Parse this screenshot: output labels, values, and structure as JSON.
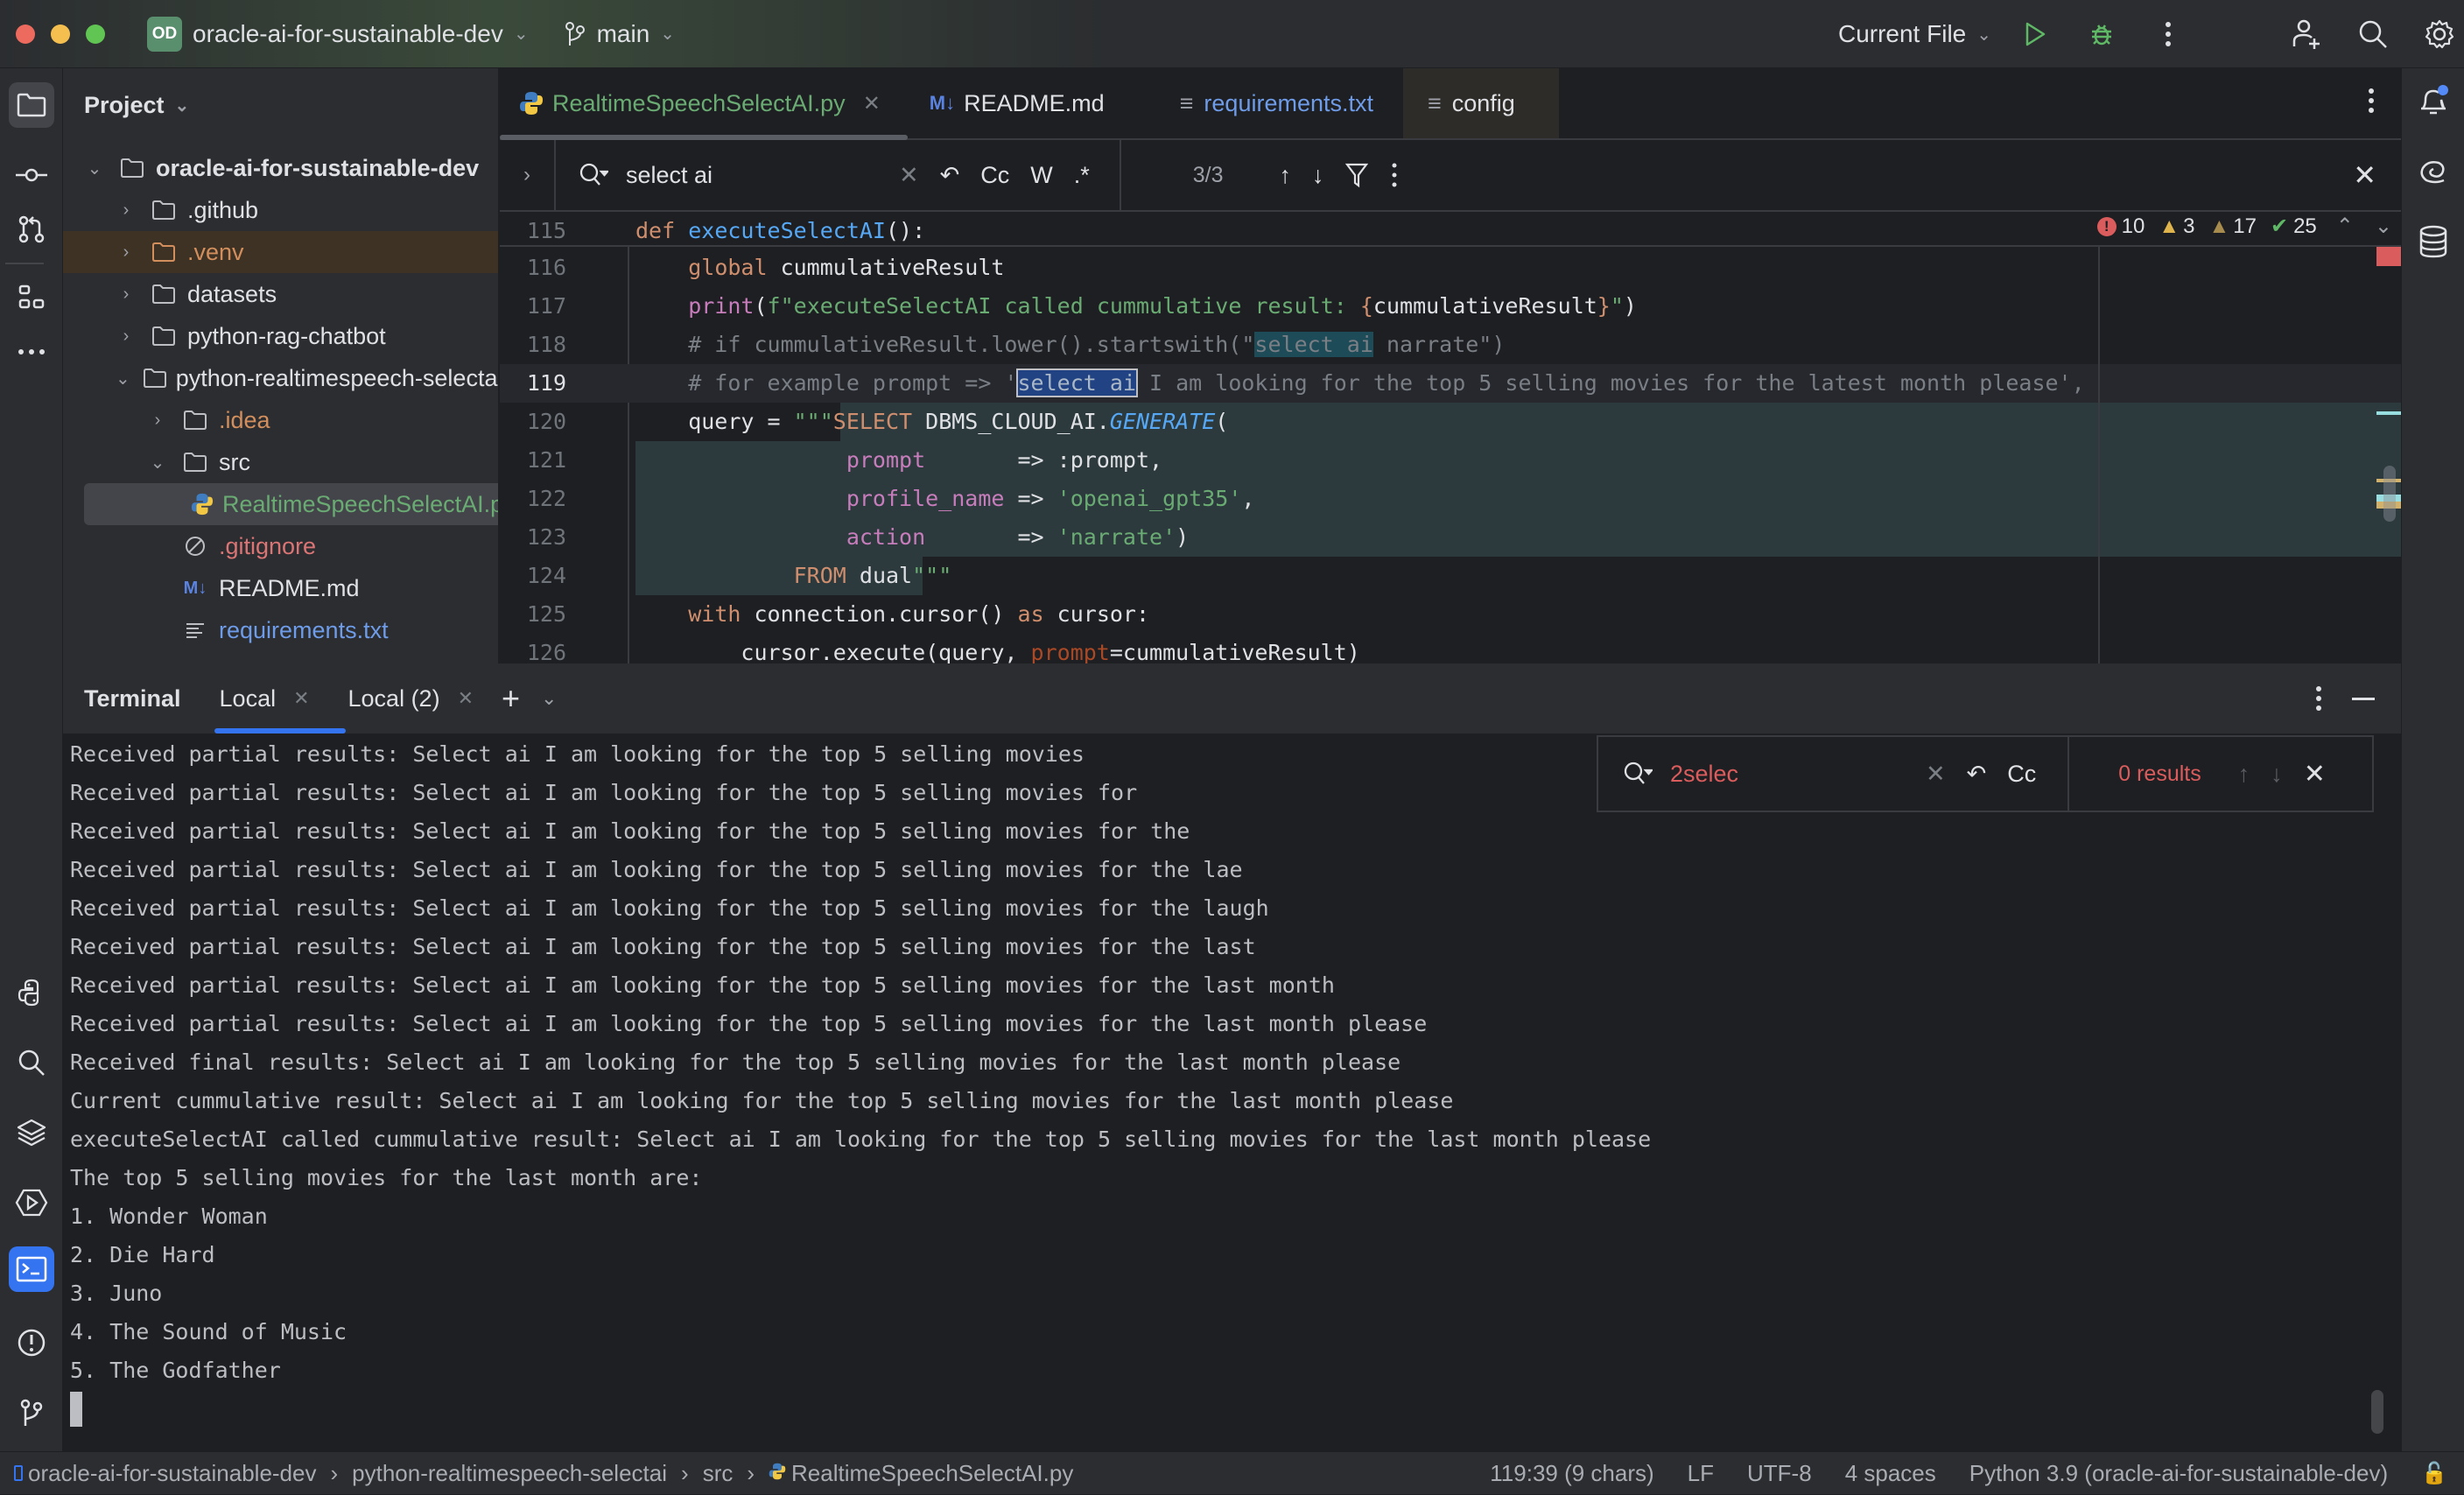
{
  "titlebar": {
    "project_badge": "OD",
    "project_name": "oracle-ai-for-sustainable-dev",
    "branch": "main",
    "run_config": "Current File"
  },
  "project_panel": {
    "title": "Project",
    "tree": [
      {
        "label": "oracle-ai-for-sustainable-dev",
        "type": "folder",
        "expanded": true,
        "level": 0,
        "bold": true
      },
      {
        "label": ".github",
        "type": "folder",
        "expanded": false,
        "level": 1
      },
      {
        "label": ".venv",
        "type": "folder-excluded",
        "expanded": false,
        "level": 1
      },
      {
        "label": "datasets",
        "type": "folder",
        "expanded": false,
        "level": 1
      },
      {
        "label": "python-rag-chatbot",
        "type": "folder",
        "expanded": false,
        "level": 1
      },
      {
        "label": "python-realtimespeech-selectai",
        "type": "folder",
        "expanded": true,
        "level": 1
      },
      {
        "label": ".idea",
        "type": "folder",
        "expanded": false,
        "level": 2
      },
      {
        "label": "src",
        "type": "folder",
        "expanded": true,
        "level": 2
      },
      {
        "label": "RealtimeSpeechSelectAI.py",
        "type": "python",
        "level": 3,
        "selected": true
      },
      {
        "label": ".gitignore",
        "type": "ignore",
        "level": 2
      },
      {
        "label": "README.md",
        "type": "markdown",
        "level": 2
      },
      {
        "label": "requirements.txt",
        "type": "text",
        "level": 2
      }
    ]
  },
  "editor": {
    "tabs": [
      {
        "label": "RealtimeSpeechSelectAI.py",
        "active": true,
        "color": "#6aab73"
      },
      {
        "label": "README.md",
        "color": "#dfe1e5"
      },
      {
        "label": "requirements.txt",
        "color": "#6f9ce8"
      },
      {
        "label": "config",
        "color": "#dfe1e5"
      }
    ],
    "find": {
      "query": "select ai",
      "match_count": "3/3",
      "opt_case": "Cc",
      "opt_word": "W",
      "opt_regex": ".*"
    },
    "inspections": {
      "errors": "10",
      "warnings": "3",
      "weak_warnings": "17",
      "ok": "25"
    },
    "lines": [
      {
        "n": "115",
        "text": "def executeSelectAI():"
      },
      {
        "n": "116",
        "text": "    global cummulativeResult"
      },
      {
        "n": "117",
        "text": "    print(f\"executeSelectAI called cummulative result: {cummulativeResult}\")"
      },
      {
        "n": "118",
        "text": "    # if cummulativeResult.lower().startswith(\"select ai narrate\")"
      },
      {
        "n": "119",
        "text": "    # for example prompt => 'select ai I am looking for the top 5 selling movies for the latest month please',"
      },
      {
        "n": "120",
        "text": "    query = \"\"\"SELECT DBMS_CLOUD_AI.GENERATE("
      },
      {
        "n": "121",
        "text": "                prompt       => :prompt,"
      },
      {
        "n": "122",
        "text": "                profile_name => 'openai_gpt35',"
      },
      {
        "n": "123",
        "text": "                action       => 'narrate')"
      },
      {
        "n": "124",
        "text": "            FROM dual\"\"\""
      },
      {
        "n": "125",
        "text": "    with connection.cursor() as cursor:"
      },
      {
        "n": "126",
        "text": "        cursor.execute(query, prompt=cummulativeResult)"
      }
    ]
  },
  "terminal": {
    "title": "Terminal",
    "tabs": [
      {
        "label": "Local",
        "active": true
      },
      {
        "label": "Local (2)"
      }
    ],
    "find": {
      "query": "2selec",
      "results": "0 results",
      "opt_case": "Cc"
    },
    "output": [
      "Received partial results: Select ai I am looking for the top 5 selling movies",
      "Received partial results: Select ai I am looking for the top 5 selling movies for",
      "Received partial results: Select ai I am looking for the top 5 selling movies for the",
      "Received partial results: Select ai I am looking for the top 5 selling movies for the lae",
      "Received partial results: Select ai I am looking for the top 5 selling movies for the laugh",
      "Received partial results: Select ai I am looking for the top 5 selling movies for the last",
      "Received partial results: Select ai I am looking for the top 5 selling movies for the last month",
      "Received partial results: Select ai I am looking for the top 5 selling movies for the last month please",
      "Received final results: Select ai I am looking for the top 5 selling movies for the last month please",
      "Current cummulative result: Select ai I am looking for the top 5 selling movies for the last month please",
      "executeSelectAI called cummulative result: Select ai I am looking for the top 5 selling movies for the last month please",
      "The top 5 selling movies for the last month are:",
      "1. Wonder Woman",
      "2. Die Hard",
      "3. Juno",
      "4. The Sound of Music",
      "5. The Godfather"
    ]
  },
  "statusbar": {
    "breadcrumb": [
      "oracle-ai-for-sustainable-dev",
      "python-realtimespeech-selectai",
      "src",
      "RealtimeSpeechSelectAI.py"
    ],
    "position": "119:39 (9 chars)",
    "line_sep": "LF",
    "encoding": "UTF-8",
    "indent": "4 spaces",
    "interpreter": "Python 3.9 (oracle-ai-for-sustainable-dev)"
  },
  "colors": {
    "accent": "#3574f0",
    "error": "#db5c5c",
    "warning": "#e0b44c",
    "ok": "#5fb865"
  }
}
